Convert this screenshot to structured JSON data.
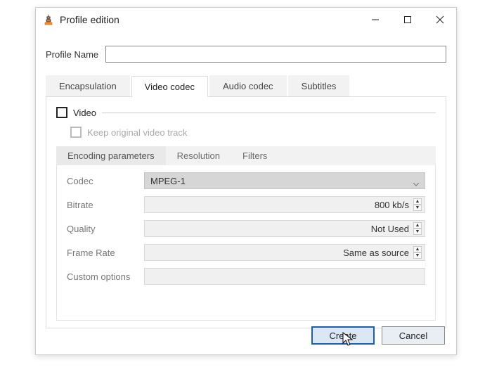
{
  "window": {
    "title": "Profile edition"
  },
  "profile": {
    "label": "Profile Name",
    "value": ""
  },
  "tabs": {
    "encapsulation": "Encapsulation",
    "video_codec": "Video codec",
    "audio_codec": "Audio codec",
    "subtitles": "Subtitles",
    "active": "video_codec"
  },
  "video": {
    "checkbox_label": "Video",
    "keep_label": "Keep original video track",
    "subtabs": {
      "encoding": "Encoding parameters",
      "resolution": "Resolution",
      "filters": "Filters",
      "active": "encoding"
    },
    "params": {
      "codec": {
        "label": "Codec",
        "value": "MPEG-1"
      },
      "bitrate": {
        "label": "Bitrate",
        "value": "800 kb/s"
      },
      "quality": {
        "label": "Quality",
        "value": "Not Used"
      },
      "framerate": {
        "label": "Frame Rate",
        "value": "Same as source"
      },
      "custom": {
        "label": "Custom options",
        "value": ""
      }
    }
  },
  "buttons": {
    "create": "Create",
    "cancel": "Cancel"
  }
}
